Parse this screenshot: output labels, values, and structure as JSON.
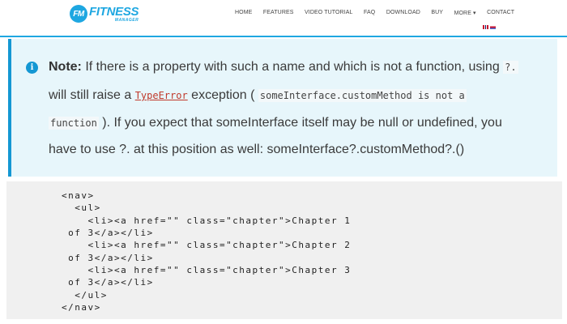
{
  "brand": {
    "badge": "FM",
    "name": "FITNESS",
    "sub": "MANAGER"
  },
  "nav": [
    "HOME",
    "FEATURES",
    "VIDEO TUTORIAL",
    "FAQ",
    "DOWNLOAD",
    "BUY",
    "MORE ▾",
    "CONTACT"
  ],
  "note": {
    "icon": "i",
    "label": "Note:",
    "l1_text": " If there is a property with such a name and which is not a function, using ",
    "l1_code": "?.",
    "l2_pre": "will still raise a ",
    "l2_link": "TypeError",
    "l2_mid": " exception ( ",
    "l2_code": "someInterface.customMethod is not a",
    "l3_code": "function",
    "l3_text": " ). If you expect that someInterface itself may be null or undefined, you",
    "l4_text": "have to use ?. at this position as well: someInterface?.customMethod?.()"
  },
  "code": [
    "<nav>",
    "  <ul>",
    "    <li><a href=\"\" class=\"chapter\">Chapter 1",
    " of 3</a></li>",
    "    <li><a href=\"\" class=\"chapter\">Chapter 2",
    " of 3</a></li>",
    "    <li><a href=\"\" class=\"chapter\">Chapter 3",
    " of 3</a></li>",
    "  </ul>",
    "</nav>"
  ]
}
